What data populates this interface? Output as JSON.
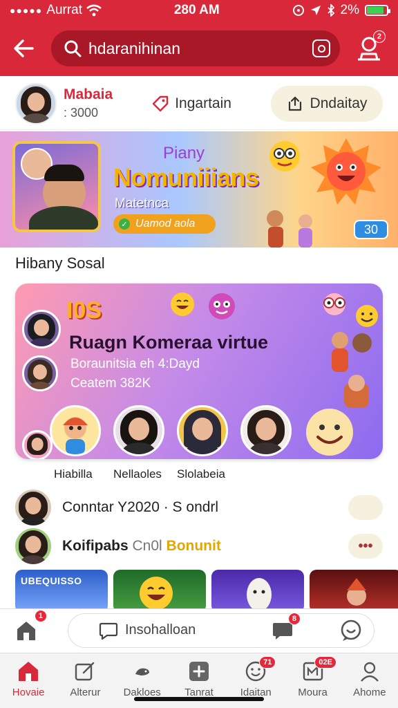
{
  "status_bar": {
    "carrier": "Aurrat",
    "time": "280 AM",
    "battery": "2%",
    "battery_level": 0.85,
    "accent": "#d9283a"
  },
  "header": {
    "search_text": "hdaranihinan",
    "notification_badge": "2"
  },
  "profile": {
    "name": "Mabaia",
    "subtitle": ": 3000",
    "action_label": "Ingartain",
    "download_label": "Dndaitay"
  },
  "banner": {
    "small_title": "Piany",
    "big_title": "Nomuniiians",
    "subtitle": "Matetnca",
    "button_label": "Uamod aola",
    "chip": "30"
  },
  "section_title": "Hibany Sosal",
  "room": {
    "tag": "I0S",
    "title": "Ruagn Komeraa virtue",
    "sub1": "Boraunitsia eh 4:Dayd",
    "sub2": "Ceatem  382K",
    "members": [
      {
        "label": "Hiabilla"
      },
      {
        "label": "Nellaoles"
      },
      {
        "label": "Slolabeia"
      }
    ]
  },
  "list": [
    {
      "text": "Conntar Y2020 · S ondrl",
      "action": ""
    },
    {
      "text_bold": "Koifipabs",
      "text_rest": " Cn0l ",
      "text_accent": "Bonunit",
      "action": "•••"
    }
  ],
  "thumbnails": [
    {
      "label": "UBEQUISSO"
    },
    {
      "label": ""
    },
    {
      "label": ""
    },
    {
      "label": ""
    }
  ],
  "bar2": {
    "home_badge": "1",
    "placeholder": "Insohalloan",
    "chat_badge": "8"
  },
  "nav": [
    {
      "label": "Hovaie",
      "badge": ""
    },
    {
      "label": "Alterur",
      "badge": ""
    },
    {
      "label": "Dakloes",
      "badge": ""
    },
    {
      "label": "Tanrat",
      "badge": ""
    },
    {
      "label": "Idaitan",
      "badge": "71"
    },
    {
      "label": "Moura",
      "badge": "02E"
    },
    {
      "label": "Ahome",
      "badge": ""
    }
  ]
}
